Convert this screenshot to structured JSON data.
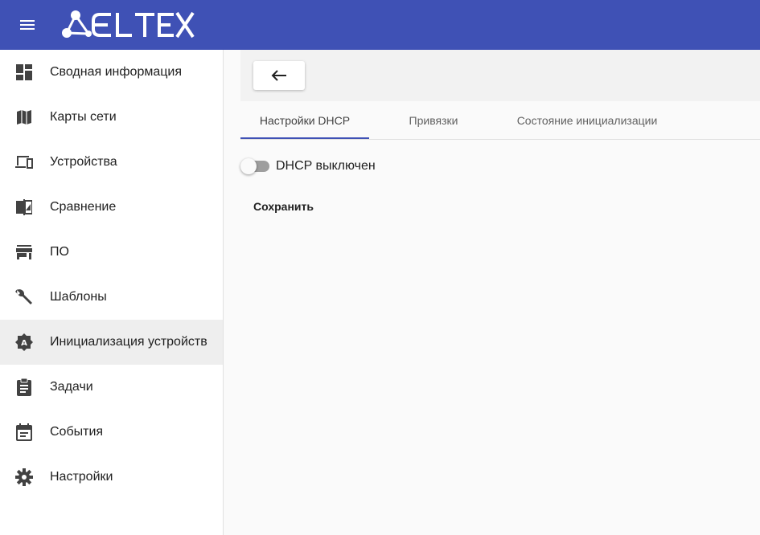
{
  "app": {
    "logo_text": "ELTEX",
    "brand_color": "#3f51b5"
  },
  "header": {
    "menu_icon": "menu-icon"
  },
  "sidebar": {
    "items": [
      {
        "label": "Сводная информация",
        "icon": "dashboard-icon",
        "active": false
      },
      {
        "label": "Карты сети",
        "icon": "map-icon",
        "active": false
      },
      {
        "label": "Устройства",
        "icon": "devices-icon",
        "active": false
      },
      {
        "label": "Сравнение",
        "icon": "compare-icon",
        "active": false
      },
      {
        "label": "ПО",
        "icon": "store-icon",
        "active": false
      },
      {
        "label": "Шаблоны",
        "icon": "wrench-icon",
        "active": false
      },
      {
        "label": "Инициализация устройств",
        "icon": "auto-init-icon",
        "active": true
      },
      {
        "label": "Задачи",
        "icon": "assignment-icon",
        "active": false
      },
      {
        "label": "События",
        "icon": "event-icon",
        "active": false
      },
      {
        "label": "Настройки",
        "icon": "gear-icon",
        "active": false
      }
    ]
  },
  "main": {
    "back_icon": "arrow-back-icon",
    "tabs": [
      {
        "label": "Настройки DHCP",
        "active": true
      },
      {
        "label": "Привязки",
        "active": false
      },
      {
        "label": "Состояние инициализации",
        "active": false
      }
    ],
    "dhcp_toggle": {
      "label": "DHCP выключен",
      "checked": false
    },
    "save_label": "Сохранить"
  }
}
